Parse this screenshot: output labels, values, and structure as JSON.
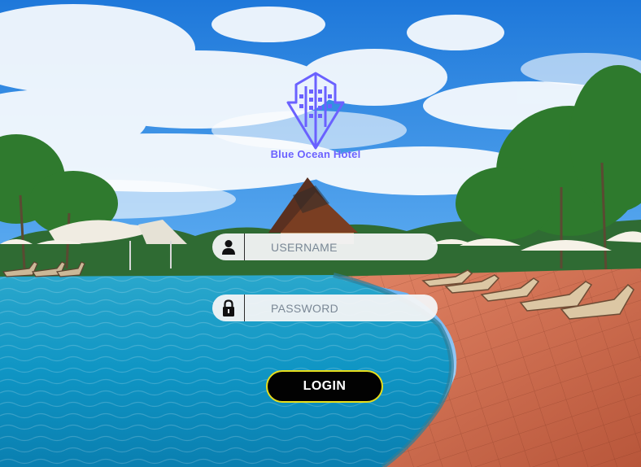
{
  "brand": {
    "name": "Blue Ocean Hotel",
    "color": "#6a61ff"
  },
  "login_form": {
    "username": {
      "placeholder": "USERNAME",
      "value": "",
      "icon": "user-icon"
    },
    "password": {
      "placeholder": "PASSWORD",
      "value": "",
      "icon": "lock-icon"
    },
    "submit_label": "LOGIN",
    "button_color": "#020202",
    "button_border_color": "#e7de1c"
  },
  "background": {
    "scene": "resort-pool-background"
  }
}
